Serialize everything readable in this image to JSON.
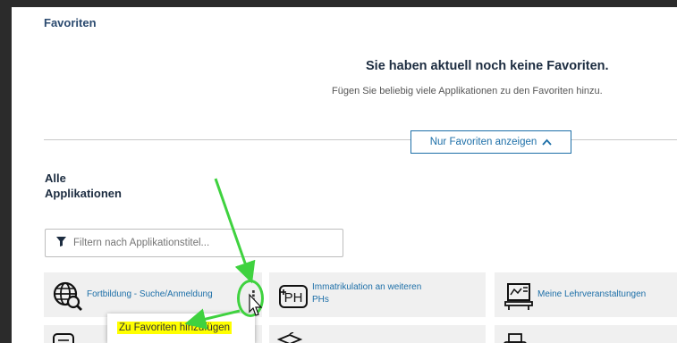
{
  "favorites": {
    "title": "Favoriten",
    "empty_title": "Sie haben aktuell noch keine Favoriten.",
    "empty_subtitle": "Fügen Sie beliebig viele Applikationen zu den Favoriten hinzu.",
    "toggle_label": "Nur Favoriten anzeigen"
  },
  "all_apps": {
    "title_line1": "Alle",
    "title_line2": "Applikationen",
    "filter_placeholder": "Filtern nach Applikationstitel..."
  },
  "tiles": [
    {
      "label": "Fortbildung - Suche/Anmeldung",
      "icon": "globe-search-icon"
    },
    {
      "label_line1": "Immatrikulation an weiteren",
      "label_line2": "PHs",
      "icon": "ph-icon"
    },
    {
      "label": "Meine Lehrveranstaltungen",
      "icon": "classroom-board-icon"
    }
  ],
  "context_menu": {
    "add_label": "Zu Favoriten hinzufügen"
  },
  "colors": {
    "accent_blue": "#1d6fa8",
    "highlight_green": "#3fd23f",
    "highlight_yellow": "#ffff00"
  }
}
